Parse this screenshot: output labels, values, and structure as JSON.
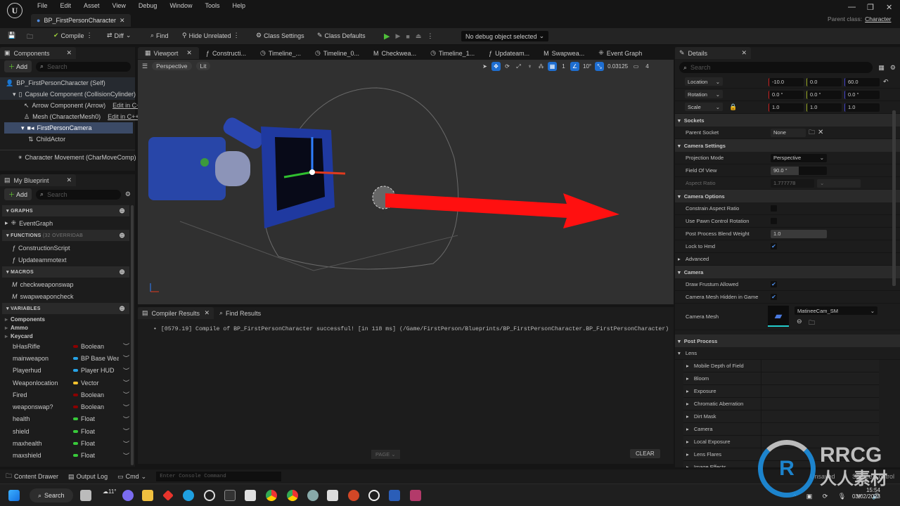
{
  "menu": {
    "items": [
      "File",
      "Edit",
      "Asset",
      "View",
      "Debug",
      "Window",
      "Tools",
      "Help"
    ]
  },
  "document_tab": "BP_FirstPersonCharacter",
  "parent_class_label": "Parent class:",
  "parent_class": "Character",
  "toolbar": {
    "compile": "Compile",
    "diff": "Diff",
    "find": "Find",
    "hide_unrelated": "Hide Unrelated",
    "class_settings": "Class Settings",
    "class_defaults": "Class Defaults",
    "debug_object": "No debug object selected"
  },
  "components": {
    "title": "Components",
    "add": "Add",
    "search_placeholder": "Search",
    "tree": [
      {
        "label": "BP_FirstPersonCharacter (Self)"
      },
      {
        "label": "Capsule Component (CollisionCylinder)"
      },
      {
        "label": "Arrow Component (Arrow)",
        "link": "Edit in C++"
      },
      {
        "label": "Mesh (CharacterMesh0)",
        "link": "Edit in C++"
      },
      {
        "label": "FirstPersonCamera"
      },
      {
        "label": "ChildActor"
      },
      {
        "label": "Character Movement (CharMoveComp)"
      }
    ]
  },
  "my_blueprint": {
    "title": "My Blueprint",
    "add": "Add",
    "search_placeholder": "Search",
    "graphs_label": "GRAPHS",
    "graphs": [
      "EventGraph"
    ],
    "functions_label": "FUNCTIONS",
    "functions_note": "(32 OVERRIDAB",
    "functions": [
      "ConstructionScript",
      "Updateammotext"
    ],
    "macros_label": "MACROS",
    "macros": [
      "checkweaponswap",
      "swapweaponcheck"
    ],
    "variables_label": "VARIABLES",
    "categories": [
      "Components",
      "Ammo",
      "Keycard"
    ],
    "variables": [
      {
        "name": "bHasRifle",
        "type": "Boolean",
        "color": "#8b0000"
      },
      {
        "name": "mainweapon",
        "type": "BP Base Weapon",
        "color": "#27a3e6"
      },
      {
        "name": "Playerhud",
        "type": "Player HUD",
        "color": "#27a3e6"
      },
      {
        "name": "Weaponlocation",
        "type": "Vector",
        "color": "#f2c12e"
      },
      {
        "name": "Fired",
        "type": "Boolean",
        "color": "#8b0000"
      },
      {
        "name": "weaponswap?",
        "type": "Boolean",
        "color": "#8b0000"
      },
      {
        "name": "health",
        "type": "Float",
        "color": "#38c93a"
      },
      {
        "name": "shield",
        "type": "Float",
        "color": "#38c93a"
      },
      {
        "name": "maxhealth",
        "type": "Float",
        "color": "#38c93a"
      },
      {
        "name": "maxshield",
        "type": "Float",
        "color": "#38c93a"
      }
    ]
  },
  "editor_tabs": [
    "Viewport",
    "Constructi...",
    "Timeline_...",
    "Timeline_0...",
    "Checkwea...",
    "Timeline_1...",
    "Updateam...",
    "Swapwea...",
    "Event Graph"
  ],
  "viewport": {
    "perspective": "Perspective",
    "lit": "Lit",
    "grid_snap": "1",
    "angle_snap": "10°",
    "scale_snap": "0.03125",
    "camera_speed": "4"
  },
  "bottom": {
    "tabs": [
      "Compiler Results",
      "Find Results"
    ],
    "log": "[0579.19] Compile of BP_FirstPersonCharacter successful! [in 118 ms] (/Game/FirstPerson/Blueprints/BP_FirstPersonCharacter.BP_FirstPersonCharacter)",
    "page": "PAGE",
    "clear": "CLEAR"
  },
  "details": {
    "title": "Details",
    "search_placeholder": "Search",
    "transform": [
      {
        "label": "Location",
        "x": "-10.0",
        "y": "0.0",
        "z": "60.0"
      },
      {
        "label": "Rotation",
        "x": "0.0 °",
        "y": "0.0 °",
        "z": "0.0 °"
      },
      {
        "label": "Scale",
        "x": "1.0",
        "y": "1.0",
        "z": "1.0"
      }
    ],
    "sockets": {
      "title": "Sockets",
      "parent_socket_label": "Parent Socket",
      "parent_socket": "None"
    },
    "camera_settings": {
      "title": "Camera Settings",
      "projection_label": "Projection Mode",
      "projection": "Perspective",
      "fov_label": "Field Of View",
      "fov": "90.0 °",
      "aspect_label": "Aspect Ratio",
      "aspect": "1.777778"
    },
    "camera_options": {
      "title": "Camera Options",
      "constrain_label": "Constrain Aspect Ratio",
      "constrain": false,
      "pawn_label": "Use Pawn Control Rotation",
      "pawn": false,
      "blend_label": "Post Process Blend Weight",
      "blend": "1.0",
      "hmd_label": "Lock to Hmd",
      "hmd": true,
      "advanced": "Advanced"
    },
    "camera": {
      "title": "Camera",
      "frustum_label": "Draw Frustum Allowed",
      "frustum": true,
      "hidden_label": "Camera Mesh Hidden in Game",
      "hidden": true,
      "mesh_label": "Camera Mesh",
      "mesh": "MatineeCam_SM"
    },
    "post_process": {
      "title": "Post Process",
      "lens": "Lens",
      "items": [
        "Mobile Depth of Field",
        "Bloom",
        "Exposure",
        "Chromatic Aberration",
        "Dirt Mask",
        "Camera",
        "Local Exposure",
        "Lens Flares",
        "Image Effects"
      ]
    }
  },
  "status": {
    "content_drawer": "Content Drawer",
    "output_log": "Output Log",
    "cmd": "Cmd",
    "console_placeholder": "Enter Console Command",
    "unsaved": "Unsaved",
    "source": "Source Control"
  },
  "taskbar": {
    "search": "Search",
    "weather": "11°",
    "time": "15:54",
    "date": "03/02/2023"
  },
  "watermark": "RRCG 人人素材"
}
